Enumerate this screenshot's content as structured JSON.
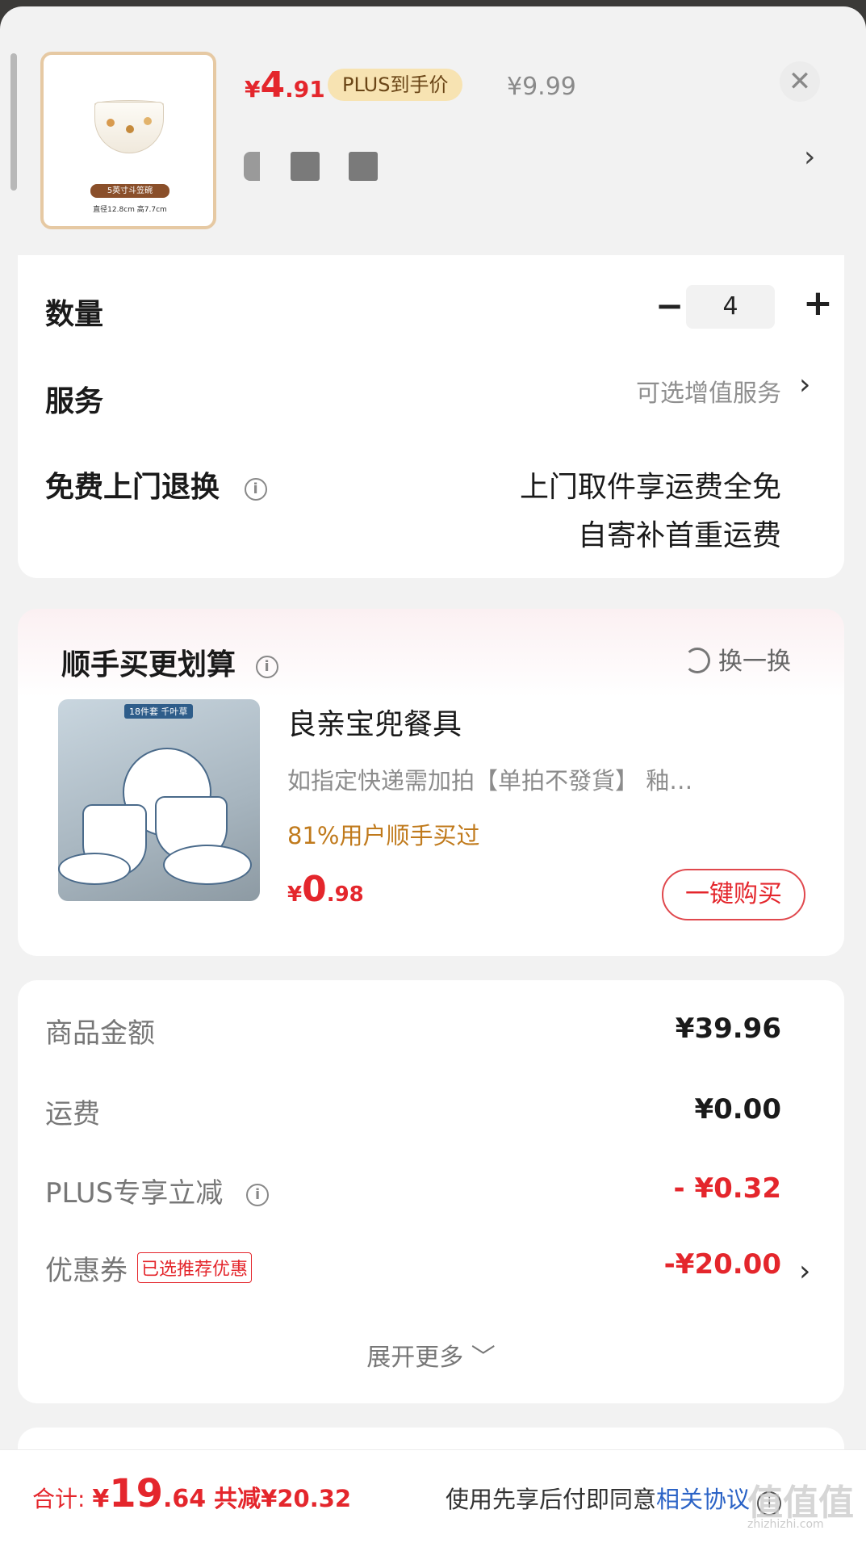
{
  "product": {
    "price_currency": "¥",
    "price_int": "4",
    "price_dec": ".91",
    "plus_badge": "PLUS到手价",
    "original_price": "¥9.99",
    "thumb_tag": "5英寸斗笠碗",
    "thumb_dims": "直径12.8cm 高7.7cm",
    "close_icon": "close-icon",
    "spec_arrow_icon": "chevron-right-icon"
  },
  "quantity": {
    "label": "数量",
    "minus": "−",
    "value": "4",
    "plus": "+"
  },
  "service": {
    "label": "服务",
    "value": "可选增值服务",
    "arrow": "›"
  },
  "returns": {
    "label": "免费上门退换",
    "info": "i",
    "line1": "上门取件享运费全免",
    "line2": "自寄补首重运费"
  },
  "recommend": {
    "title": "顺手买更划算",
    "info": "i",
    "swap_label": "换一换",
    "image_label": "18件套 千叶草",
    "name": "良亲宝兜餐具",
    "desc": "如指定快递需加拍【单拍不發貨】  釉…",
    "stat": "81%用户顺手买过",
    "price_currency": "¥",
    "price_int": "0",
    "price_dec": ".98",
    "buy_label": "一键购买"
  },
  "fees": {
    "goods_label": "商品金额",
    "goods_value": "¥39.96",
    "shipping_label": "运费",
    "shipping_value": "¥0.00",
    "plus_label": "PLUS专享立减",
    "plus_value": "- ¥0.32",
    "coupon_label": "优惠券",
    "coupon_tag": "已选推荐优惠",
    "coupon_value": "-¥20.00",
    "expand_label": "展开更多 ﹀"
  },
  "bottom": {
    "total_label": "合计: ",
    "total_currency": "¥",
    "total_int": "19",
    "total_dec": ".64",
    "savings": "共减¥20.32",
    "agree_text": "使用先享后付即同意",
    "agree_link": "相关协议",
    "agree_icon": "i"
  },
  "watermark": {
    "text": "值值值",
    "sub": "zhizhizhi.com"
  },
  "colors": {
    "accent_red": "#e4262c",
    "plus_gold": "#f7e3b2",
    "link_blue": "#2b63c6",
    "stat_orange": "#c07a1c"
  }
}
